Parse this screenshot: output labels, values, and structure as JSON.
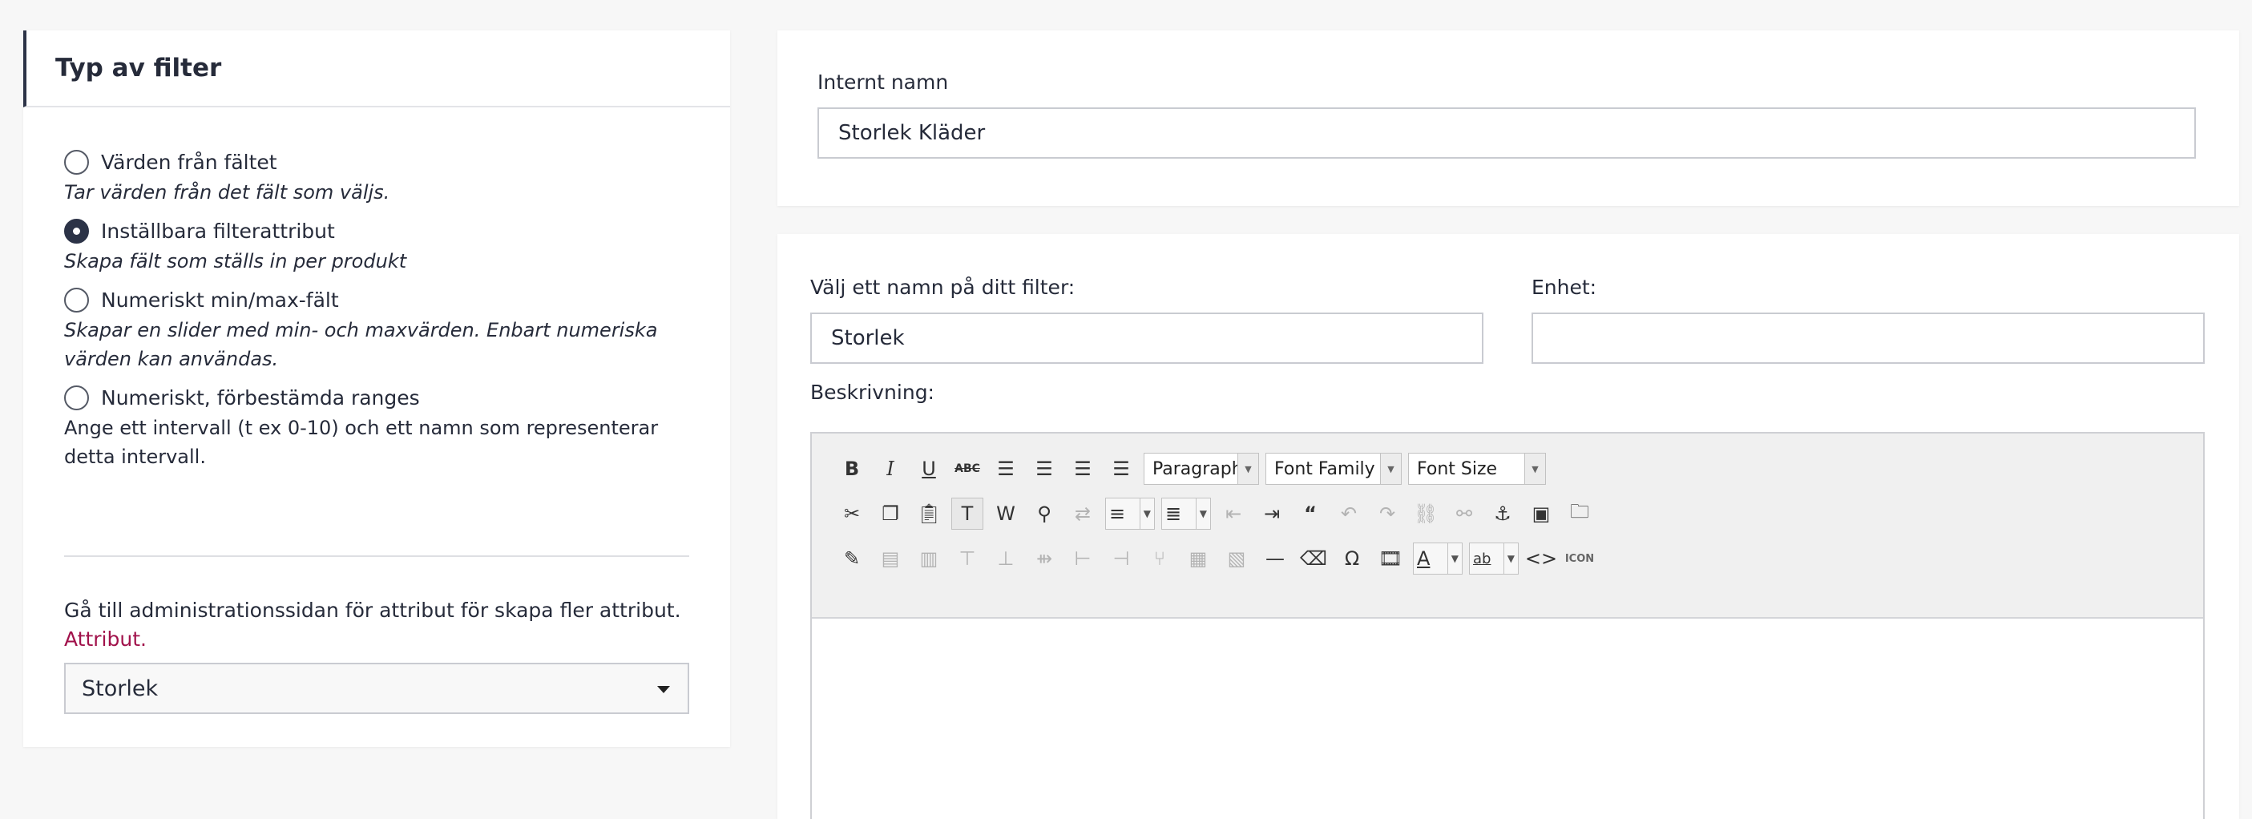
{
  "left_panel": {
    "title": "Typ av filter",
    "options": [
      {
        "label": "Värden från fältet",
        "description": "Tar värden från det fält som väljs.",
        "checked": false
      },
      {
        "label": "Inställbara filterattribut",
        "description": "Skapa fält som ställs in per produkt",
        "checked": true
      },
      {
        "label": "Numeriskt min/max-fält",
        "description": "Skapar en slider med min- och maxvärden. Enbart numeriska värden kan användas.",
        "checked": false
      },
      {
        "label": "Numeriskt, förbestämda ranges",
        "description": "Ange ett intervall (t ex 0-10) och ett namn som representerar detta intervall.",
        "checked": false
      }
    ],
    "admin_text": "Gå till administrationssidan för attribut för skapa fler attribut.",
    "admin_link": "Attribut.",
    "attribute_select_value": "Storlek"
  },
  "top_panel": {
    "internal_name_label": "Internt namn",
    "internal_name_value": "Storlek Kläder"
  },
  "main_panel": {
    "filter_name_label": "Välj ett namn på ditt filter:",
    "filter_name_value": "Storlek",
    "unit_label": "Enhet:",
    "unit_value": "",
    "description_label": "Beskrivning:"
  },
  "editor_toolbar": {
    "paragraph_select": "Paragraph",
    "font_family_select": "Font Family",
    "font_size_select": "Font Size",
    "row1_icons": [
      "bold-icon",
      "italic-icon",
      "underline-icon",
      "strikethrough-icon",
      "align-left-icon",
      "align-center-icon",
      "align-right-icon",
      "align-justify-icon"
    ],
    "row2_icons": [
      "cut-icon",
      "copy-icon",
      "paste-icon",
      "paste-text-icon",
      "paste-word-icon",
      "find-icon",
      "replace-icon",
      "bullet-list-icon",
      "numbered-list-icon",
      "outdent-icon",
      "indent-icon",
      "blockquote-icon",
      "undo-icon",
      "redo-icon",
      "link-icon",
      "unlink-icon",
      "anchor-icon",
      "image-icon",
      "file-manager-icon"
    ],
    "row3_icons": [
      "edit-icon",
      "table-icons",
      "horizontal-rule-icon",
      "eraser-icon",
      "omega-icon",
      "media-icon",
      "text-color-icon",
      "highlight-color-icon",
      "code-icon",
      "icon-icon"
    ],
    "icon_text_label": "ICON",
    "colors": {
      "accent_border": "#2c3347",
      "link": "#a1124b",
      "toolbar_bg": "#f0f0f0"
    }
  }
}
